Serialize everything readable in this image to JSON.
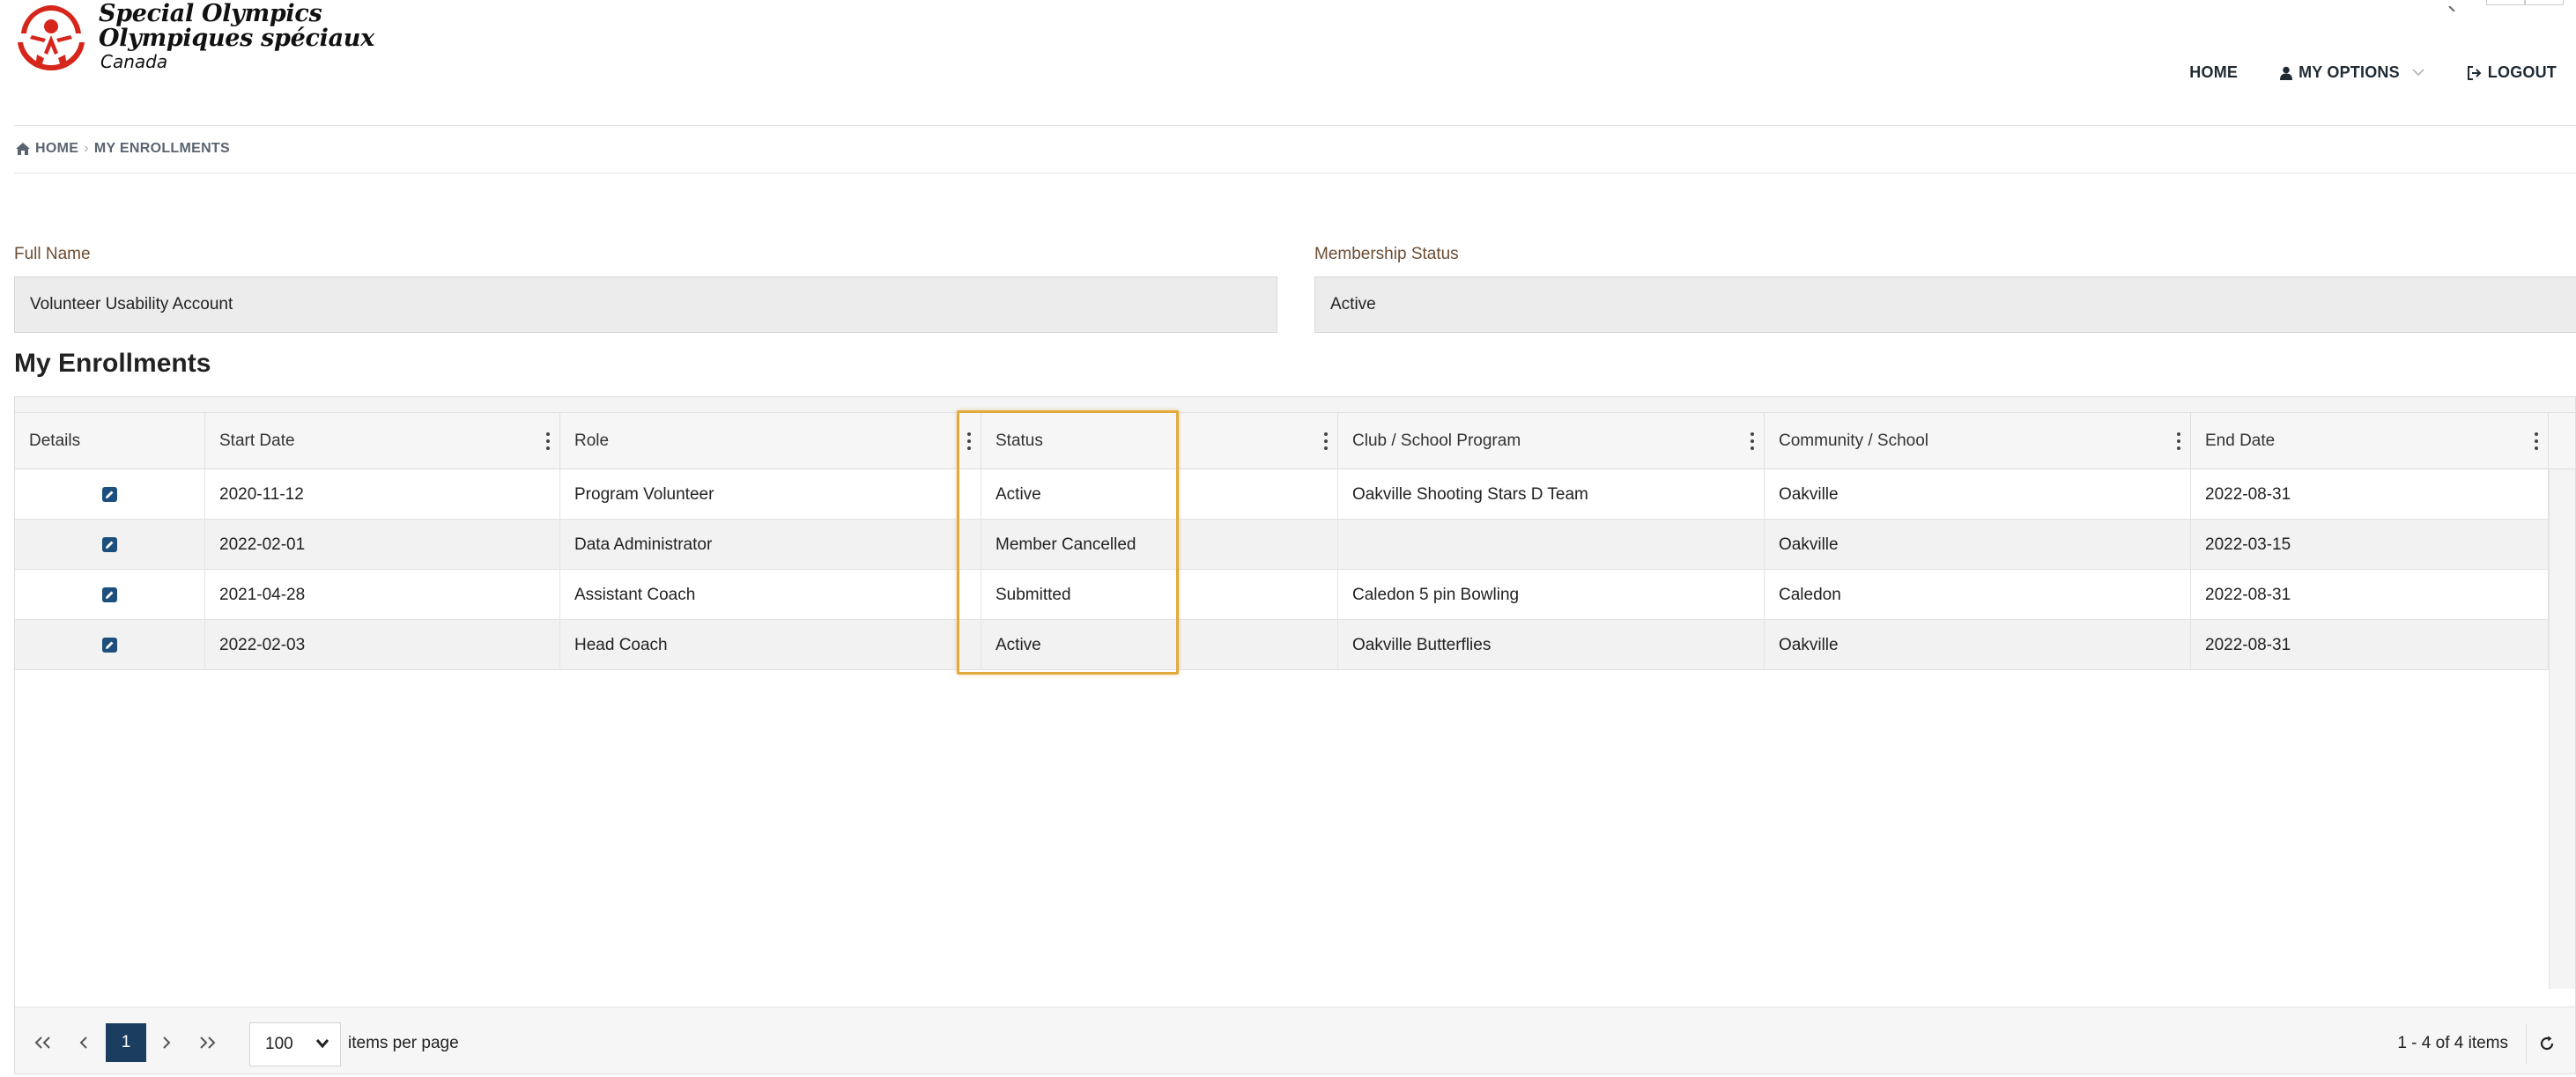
{
  "logo": {
    "line1": "Special Olympics",
    "line2": "Olympiques spéciaux",
    "line3": "Canada"
  },
  "nav": {
    "home": "HOME",
    "my_options": "MY OPTIONS",
    "logout": "LOGOUT"
  },
  "breadcrumb": {
    "home": "HOME",
    "current": "MY ENROLLMENTS"
  },
  "form": {
    "full_name_label": "Full Name",
    "full_name_value": "Volunteer Usability Account",
    "membership_label": "Membership Status",
    "membership_value": "Active"
  },
  "section_title": "My Enrollments",
  "grid": {
    "columns": [
      "Details",
      "Start Date",
      "Role",
      "Status",
      "Club / School Program",
      "Community / School",
      "End Date"
    ],
    "rows": [
      {
        "start": "2020-11-12",
        "role": "Program Volunteer",
        "status": "Active",
        "club": "Oakville Shooting Stars D Team",
        "community": "Oakville",
        "end": "2022-08-31"
      },
      {
        "start": "2022-02-01",
        "role": "Data Administrator",
        "status": "Member Cancelled",
        "club": "",
        "community": "Oakville",
        "end": "2022-03-15"
      },
      {
        "start": "2021-04-28",
        "role": "Assistant Coach",
        "status": "Submitted",
        "club": "Caledon 5 pin Bowling",
        "community": "Caledon",
        "end": "2022-08-31"
      },
      {
        "start": "2022-02-03",
        "role": "Head Coach",
        "status": "Active",
        "club": "Oakville Butterflies",
        "community": "Oakville",
        "end": "2022-08-31"
      }
    ]
  },
  "pager": {
    "current_page": "1",
    "page_size": "100",
    "items_per_page_label": "items per page",
    "info": "1 - 4 of 4 items"
  },
  "colors": {
    "accent_dark_blue": "#1b3d5f",
    "highlight": "#e2a93b",
    "logo_red": "#d6261c",
    "label_brown": "#6b4c33"
  }
}
